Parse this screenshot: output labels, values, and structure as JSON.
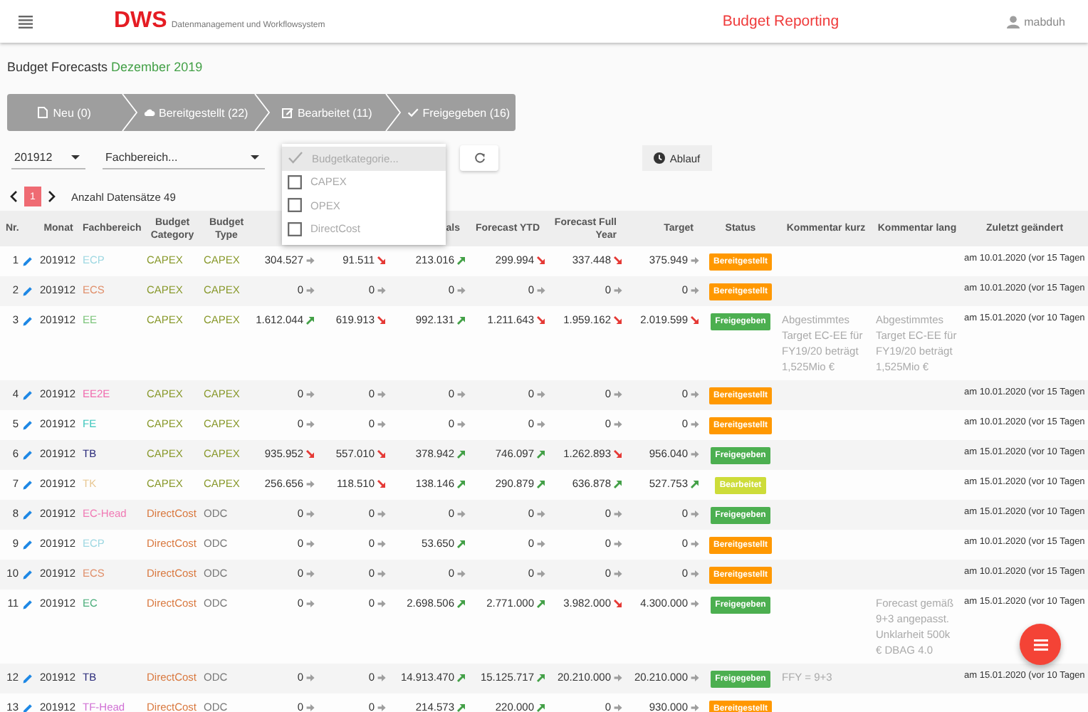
{
  "header": {
    "app_name": "DWS",
    "app_subtitle": "Datenmanagement und Workflowsystem",
    "page_title": "Budget Reporting",
    "user": "mabduh"
  },
  "heading": {
    "text": "Budget Forecasts",
    "period": "Dezember 2019"
  },
  "steps": [
    {
      "kind": "new",
      "label": "Neu (0)"
    },
    {
      "kind": "provided",
      "label": "Bereitgestellt (22)"
    },
    {
      "kind": "edited",
      "label": "Bearbeitet (11)"
    },
    {
      "kind": "approved",
      "label": "Freigegeben (16)"
    }
  ],
  "filters": {
    "month": {
      "value": "201912"
    },
    "department": {
      "placeholder": "Fachbereich..."
    }
  },
  "category_menu": {
    "header": {
      "label": "Budgetkategorie...",
      "checked": true,
      "selected": true
    },
    "options": [
      {
        "label": "CAPEX",
        "checked": false,
        "selected": false
      },
      {
        "label": "OPEX",
        "checked": false,
        "selected": false
      },
      {
        "label": "DirectCost",
        "checked": false,
        "selected": false
      }
    ]
  },
  "flow_button": {
    "label": "Ablauf"
  },
  "pagination": {
    "pages": [
      {
        "label": "1",
        "selected": true
      }
    ],
    "count": "Anzahl Datensätze  49"
  },
  "table": {
    "columns": [
      {
        "label": "Nr."
      },
      {
        "label": "Monat"
      },
      {
        "label": "Fachbereich"
      },
      {
        "label": "Budget Category"
      },
      {
        "label": "Budget Type"
      },
      {},
      {},
      {
        "label": "als"
      },
      {
        "label": "Forecast YTD"
      },
      {
        "label": "Forecast Full Year"
      },
      {
        "label": "Target"
      },
      {
        "label": "Status"
      },
      {
        "label": "Kommentar kurz"
      },
      {
        "label": "Kommentar lang"
      },
      {
        "label": "Zuletzt geändert"
      }
    ],
    "rows": [
      {
        "nr": "1",
        "month": "201912",
        "department": {
          "text": "ECP",
          "color": "#9fd8e2"
        },
        "category": {
          "kind": "capex",
          "text": "CAPEX"
        },
        "type": {
          "kind": "capex",
          "text": "CAPEX"
        },
        "values": [
          {
            "text": "304.527",
            "kind": "flat"
          },
          {
            "text": "91.511",
            "kind": "down"
          },
          {
            "text": "213.016",
            "kind": "up"
          },
          {
            "text": "299.994",
            "kind": "down"
          },
          {
            "text": "337.448",
            "kind": "down"
          },
          {
            "text": "375.949",
            "kind": "flat"
          }
        ],
        "status": {
          "kind": "provided",
          "label": "Bereitgestellt"
        },
        "changed": "am 10.01.2020 (vor 15 Tagen"
      },
      {
        "nr": "2",
        "month": "201912",
        "department": {
          "text": "ECS",
          "color": "#e0906c"
        },
        "category": {
          "kind": "capex",
          "text": "CAPEX"
        },
        "type": {
          "kind": "capex",
          "text": "CAPEX"
        },
        "values": [
          {
            "text": "0",
            "kind": "flat"
          },
          {
            "text": "0",
            "kind": "flat"
          },
          {
            "text": "0",
            "kind": "flat"
          },
          {
            "text": "0",
            "kind": "flat"
          },
          {
            "text": "0",
            "kind": "flat"
          },
          {
            "text": "0",
            "kind": "flat"
          }
        ],
        "status": {
          "kind": "provided",
          "label": "Bereitgestellt"
        },
        "changed": "am 10.01.2020 (vor 15 Tagen"
      },
      {
        "nr": "3",
        "month": "201912",
        "department": {
          "text": "EE",
          "color": "#7cc47a"
        },
        "category": {
          "kind": "capex",
          "text": "CAPEX"
        },
        "type": {
          "kind": "capex",
          "text": "CAPEX"
        },
        "values": [
          {
            "text": "1.612.044",
            "kind": "up"
          },
          {
            "text": "619.913",
            "kind": "down"
          },
          {
            "text": "992.131",
            "kind": "up"
          },
          {
            "text": "1.211.643",
            "kind": "down"
          },
          {
            "text": "1.959.162",
            "kind": "down"
          },
          {
            "text": "2.019.599",
            "kind": "down"
          }
        ],
        "status": {
          "kind": "approved",
          "label": "Freigegeben"
        },
        "comment_short": "Abgestimmtes Target EC-EE für FY19/20 beträgt 1,525Mio €",
        "comment_long": "Abgestimmtes Target EC-EE für FY19/20 beträgt 1,525Mio €",
        "changed": "am 15.01.2020 (vor 10 Tagen"
      },
      {
        "nr": "4",
        "month": "201912",
        "department": {
          "text": "EE2E",
          "color": "#f06aae"
        },
        "category": {
          "kind": "capex",
          "text": "CAPEX"
        },
        "type": {
          "kind": "capex",
          "text": "CAPEX"
        },
        "values": [
          {
            "text": "0",
            "kind": "flat"
          },
          {
            "text": "0",
            "kind": "flat"
          },
          {
            "text": "0",
            "kind": "flat"
          },
          {
            "text": "0",
            "kind": "flat"
          },
          {
            "text": "0",
            "kind": "flat"
          },
          {
            "text": "0",
            "kind": "flat"
          }
        ],
        "status": {
          "kind": "provided",
          "label": "Bereitgestellt"
        },
        "changed": "am 10.01.2020 (vor 15 Tagen"
      },
      {
        "nr": "5",
        "month": "201912",
        "department": {
          "text": "FE",
          "color": "#3cc6bc"
        },
        "category": {
          "kind": "capex",
          "text": "CAPEX"
        },
        "type": {
          "kind": "capex",
          "text": "CAPEX"
        },
        "values": [
          {
            "text": "0",
            "kind": "flat"
          },
          {
            "text": "0",
            "kind": "flat"
          },
          {
            "text": "0",
            "kind": "flat"
          },
          {
            "text": "0",
            "kind": "flat"
          },
          {
            "text": "0",
            "kind": "flat"
          },
          {
            "text": "0",
            "kind": "flat"
          }
        ],
        "status": {
          "kind": "provided",
          "label": "Bereitgestellt"
        },
        "changed": "am 10.01.2020 (vor 15 Tagen"
      },
      {
        "nr": "6",
        "month": "201912",
        "department": {
          "text": "TB",
          "color": "#2a2a7a"
        },
        "category": {
          "kind": "capex",
          "text": "CAPEX"
        },
        "type": {
          "kind": "capex",
          "text": "CAPEX"
        },
        "values": [
          {
            "text": "935.952",
            "kind": "down"
          },
          {
            "text": "557.010",
            "kind": "down"
          },
          {
            "text": "378.942",
            "kind": "up"
          },
          {
            "text": "746.097",
            "kind": "up"
          },
          {
            "text": "1.262.893",
            "kind": "down"
          },
          {
            "text": "956.040",
            "kind": "flat"
          }
        ],
        "status": {
          "kind": "approved",
          "label": "Freigegeben"
        },
        "changed": "am 15.01.2020 (vor 10 Tagen"
      },
      {
        "nr": "7",
        "month": "201912",
        "department": {
          "text": "TK",
          "color": "#e8c894"
        },
        "category": {
          "kind": "capex",
          "text": "CAPEX"
        },
        "type": {
          "kind": "capex",
          "text": "CAPEX"
        },
        "values": [
          {
            "text": "256.656",
            "kind": "flat"
          },
          {
            "text": "118.510",
            "kind": "down"
          },
          {
            "text": "138.146",
            "kind": "up"
          },
          {
            "text": "290.879",
            "kind": "up"
          },
          {
            "text": "636.878",
            "kind": "up"
          },
          {
            "text": "527.753",
            "kind": "up"
          }
        ],
        "status": {
          "kind": "edited",
          "label": "Bearbeitet"
        },
        "changed": "am 15.01.2020 (vor 10 Tagen"
      },
      {
        "nr": "8",
        "month": "201912",
        "department": {
          "text": "EC-Head",
          "color": "#f07ab4"
        },
        "category": {
          "kind": "directcost",
          "text": "DirectCost"
        },
        "type": {
          "kind": "odc",
          "text": "ODC"
        },
        "values": [
          {
            "text": "0",
            "kind": "flat"
          },
          {
            "text": "0",
            "kind": "flat"
          },
          {
            "text": "0",
            "kind": "flat"
          },
          {
            "text": "0",
            "kind": "flat"
          },
          {
            "text": "0",
            "kind": "flat"
          },
          {
            "text": "0",
            "kind": "flat"
          }
        ],
        "status": {
          "kind": "approved",
          "label": "Freigegeben"
        },
        "changed": "am 15.01.2020 (vor 10 Tagen"
      },
      {
        "nr": "9",
        "month": "201912",
        "department": {
          "text": "ECP",
          "color": "#9fd8e2"
        },
        "category": {
          "kind": "directcost",
          "text": "DirectCost"
        },
        "type": {
          "kind": "odc",
          "text": "ODC"
        },
        "values": [
          {
            "text": "0",
            "kind": "flat"
          },
          {
            "text": "0",
            "kind": "flat"
          },
          {
            "text": "53.650",
            "kind": "up"
          },
          {
            "text": "0",
            "kind": "flat"
          },
          {
            "text": "0",
            "kind": "flat"
          },
          {
            "text": "0",
            "kind": "flat"
          }
        ],
        "status": {
          "kind": "provided",
          "label": "Bereitgestellt"
        },
        "changed": "am 10.01.2020 (vor 15 Tagen"
      },
      {
        "nr": "10",
        "month": "201912",
        "department": {
          "text": "ECS",
          "color": "#e0906c"
        },
        "category": {
          "kind": "directcost",
          "text": "DirectCost"
        },
        "type": {
          "kind": "odc",
          "text": "ODC"
        },
        "values": [
          {
            "text": "0",
            "kind": "flat"
          },
          {
            "text": "0",
            "kind": "flat"
          },
          {
            "text": "0",
            "kind": "flat"
          },
          {
            "text": "0",
            "kind": "flat"
          },
          {
            "text": "0",
            "kind": "flat"
          },
          {
            "text": "0",
            "kind": "flat"
          }
        ],
        "status": {
          "kind": "provided",
          "label": "Bereitgestellt"
        },
        "changed": "am 10.01.2020 (vor 15 Tagen"
      },
      {
        "nr": "11",
        "month": "201912",
        "department": {
          "text": "EC",
          "color": "#4cae7c"
        },
        "category": {
          "kind": "directcost",
          "text": "DirectCost"
        },
        "type": {
          "kind": "odc",
          "text": "ODC"
        },
        "values": [
          {
            "text": "0",
            "kind": "flat"
          },
          {
            "text": "0",
            "kind": "flat"
          },
          {
            "text": "2.698.506",
            "kind": "up"
          },
          {
            "text": "2.771.000",
            "kind": "up"
          },
          {
            "text": "3.982.000",
            "kind": "down"
          },
          {
            "text": "4.300.000",
            "kind": "flat"
          }
        ],
        "status": {
          "kind": "approved",
          "label": "Freigegeben"
        },
        "comment_long": "Forecast gemäß 9+3 angepasst. Unklarheit 500k € DBAG 4.0",
        "changed": "am 15.01.2020 (vor 10 Tagen"
      },
      {
        "nr": "12",
        "month": "201912",
        "department": {
          "text": "TB",
          "color": "#2a2a7a"
        },
        "category": {
          "kind": "directcost",
          "text": "DirectCost"
        },
        "type": {
          "kind": "odc",
          "text": "ODC"
        },
        "values": [
          {
            "text": "0",
            "kind": "flat"
          },
          {
            "text": "0",
            "kind": "flat"
          },
          {
            "text": "14.913.470",
            "kind": "up"
          },
          {
            "text": "15.125.717",
            "kind": "up"
          },
          {
            "text": "20.210.000",
            "kind": "flat"
          },
          {
            "text": "20.210.000",
            "kind": "flat"
          }
        ],
        "status": {
          "kind": "approved",
          "label": "Freigegeben"
        },
        "comment_short": "FFY = 9+3",
        "changed": "am 15.01.2020 (vor 10 Tagen"
      },
      {
        "nr": "13",
        "month": "201912",
        "department": {
          "text": "TF-Head",
          "color": "#d070d4"
        },
        "category": {
          "kind": "directcost",
          "text": "DirectCost"
        },
        "type": {
          "kind": "odc",
          "text": "ODC"
        },
        "values": [
          {
            "text": "0",
            "kind": "flat"
          },
          {
            "text": "0",
            "kind": "flat"
          },
          {
            "text": "214.573",
            "kind": "up"
          },
          {
            "text": "220.000",
            "kind": "up"
          },
          {
            "text": "0",
            "kind": "flat"
          },
          {
            "text": "930.000",
            "kind": "flat"
          }
        ],
        "status": {
          "kind": "provided",
          "label": "Bereitgestellt"
        }
      }
    ]
  }
}
